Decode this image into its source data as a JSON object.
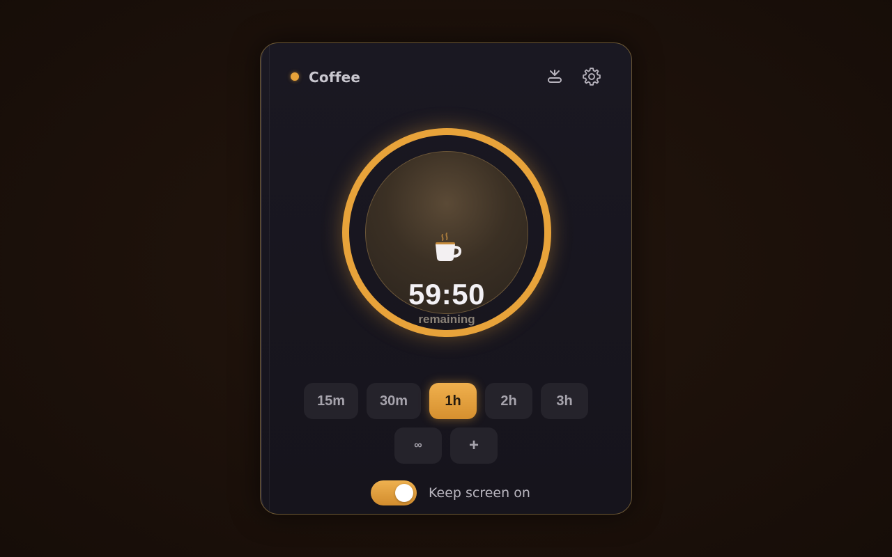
{
  "app": {
    "title": "Coffee",
    "status_color": "#e8a33a"
  },
  "header": {
    "minimize_icon": "minimize-to-tray-icon",
    "settings_icon": "gear-icon"
  },
  "timer": {
    "icon": "coffee-cup-icon",
    "time_remaining": "59:50",
    "caption": "remaining",
    "progress": 1.0,
    "accent_color": "#e8a33a"
  },
  "presets": {
    "row1": [
      {
        "label": "15m",
        "active": false
      },
      {
        "label": "30m",
        "active": false
      },
      {
        "label": "1h",
        "active": true
      },
      {
        "label": "2h",
        "active": false
      },
      {
        "label": "3h",
        "active": false
      }
    ],
    "row2": [
      {
        "label": "∞",
        "active": false
      },
      {
        "label": "+",
        "active": false
      }
    ]
  },
  "keep_screen_on": {
    "label": "Keep screen on",
    "enabled": true
  }
}
